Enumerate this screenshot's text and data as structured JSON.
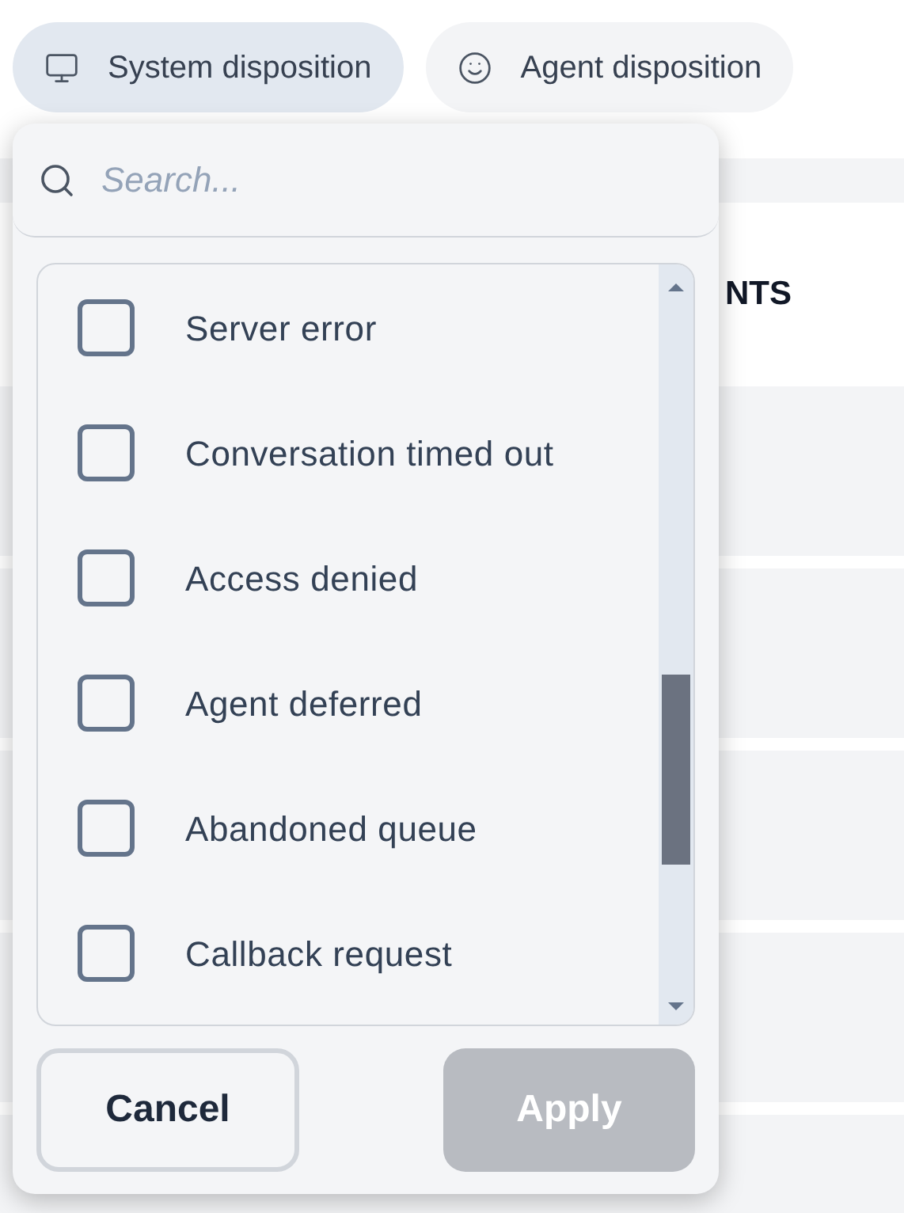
{
  "filter_tabs": [
    {
      "label": "System disposition",
      "selected": true
    },
    {
      "label": "Agent disposition",
      "selected": false
    }
  ],
  "table": {
    "heading": "NTS"
  },
  "dropdown": {
    "search": {
      "placeholder": "Search..."
    },
    "options": [
      {
        "label": "Server error",
        "checked": false
      },
      {
        "label": "Conversation timed out",
        "checked": false
      },
      {
        "label": "Access denied",
        "checked": false
      },
      {
        "label": "Agent deferred",
        "checked": false
      },
      {
        "label": "Abandoned queue",
        "checked": false
      },
      {
        "label": "Callback request",
        "checked": false
      }
    ],
    "cancel": "Cancel",
    "apply": {
      "label": "Apply",
      "disabled": true
    }
  }
}
